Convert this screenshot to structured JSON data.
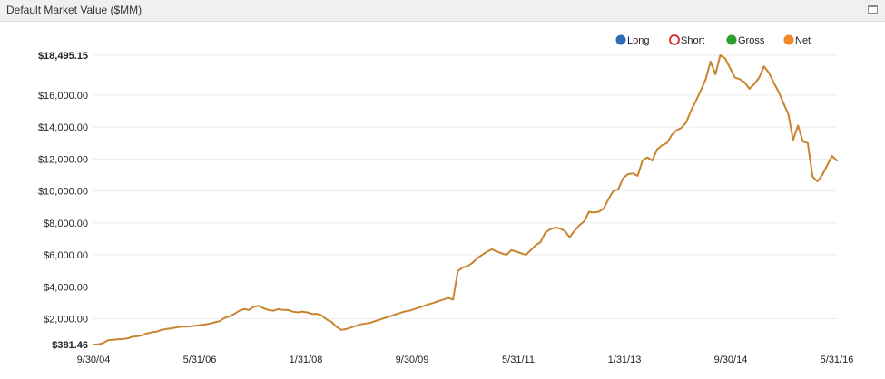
{
  "panel": {
    "title": "Default Market Value ($MM)",
    "maximize_icon": "window-maximize-icon"
  },
  "chart_data": {
    "type": "line",
    "title": "Default Market Value ($MM)",
    "xlabel": "",
    "ylabel": "",
    "ylim": [
      381.46,
      18495.15
    ],
    "grid": "horizontal",
    "legend_position": "top-right",
    "legend": [
      {
        "name": "Long",
        "color": "#2f6db5",
        "marker": "filled"
      },
      {
        "name": "Short",
        "color": "#d9262c",
        "marker": "hollow"
      },
      {
        "name": "Gross",
        "color": "#2ca02c",
        "marker": "filled"
      },
      {
        "name": "Net",
        "color": "#f28a2a",
        "marker": "filled"
      }
    ],
    "y_ticks": [
      {
        "value": 381.46,
        "label": "$381.46",
        "bold": true
      },
      {
        "value": 2000,
        "label": "$2,000.00"
      },
      {
        "value": 4000,
        "label": "$4,000.00"
      },
      {
        "value": 6000,
        "label": "$6,000.00"
      },
      {
        "value": 8000,
        "label": "$8,000.00"
      },
      {
        "value": 10000,
        "label": "$10,000.00"
      },
      {
        "value": 12000,
        "label": "$12,000.00"
      },
      {
        "value": 14000,
        "label": "$14,000.00"
      },
      {
        "value": 16000,
        "label": "$16,000.00"
      },
      {
        "value": 18495.15,
        "label": "$18,495.15",
        "bold": true
      }
    ],
    "x_ticks": [
      "9/30/04",
      "5/31/06",
      "1/31/08",
      "9/30/09",
      "5/31/11",
      "1/31/13",
      "9/30/14",
      "5/31/16"
    ],
    "series": [
      {
        "name": "Net",
        "color": "#c8842e",
        "values": [
          381,
          400,
          480,
          650,
          680,
          710,
          720,
          760,
          870,
          900,
          960,
          1080,
          1150,
          1190,
          1300,
          1350,
          1400,
          1450,
          1500,
          1500,
          1520,
          1560,
          1600,
          1650,
          1700,
          1780,
          1850,
          2050,
          2150,
          2300,
          2500,
          2600,
          2550,
          2750,
          2800,
          2650,
          2550,
          2500,
          2600,
          2550,
          2550,
          2450,
          2400,
          2450,
          2400,
          2300,
          2300,
          2200,
          1950,
          1800,
          1500,
          1300,
          1350,
          1450,
          1550,
          1650,
          1700,
          1750,
          1850,
          1950,
          2050,
          2150,
          2250,
          2350,
          2450,
          2500,
          2600,
          2700,
          2800,
          2900,
          3000,
          3100,
          3200,
          3300,
          3200,
          5000,
          5200,
          5300,
          5500,
          5800,
          6000,
          6200,
          6350,
          6200,
          6100,
          6000,
          6300,
          6200,
          6100,
          6000,
          6300,
          6600,
          6800,
          7400,
          7600,
          7700,
          7650,
          7500,
          7100,
          7500,
          7850,
          8100,
          8700,
          8650,
          8700,
          8900,
          9500,
          10000,
          10100,
          10800,
          11050,
          11100,
          10950,
          11900,
          12100,
          11900,
          12600,
          12850,
          13000,
          13500,
          13800,
          13950,
          14300,
          15050,
          15650,
          16300,
          17000,
          18100,
          17300,
          18495,
          18300,
          17700,
          17100,
          17000,
          16800,
          16400,
          16700,
          17100,
          17800,
          17400,
          16800,
          16200,
          15500,
          14800,
          13200,
          14100,
          13100,
          13000,
          10900,
          10600,
          11000,
          11600,
          12200,
          11900
        ]
      }
    ]
  }
}
